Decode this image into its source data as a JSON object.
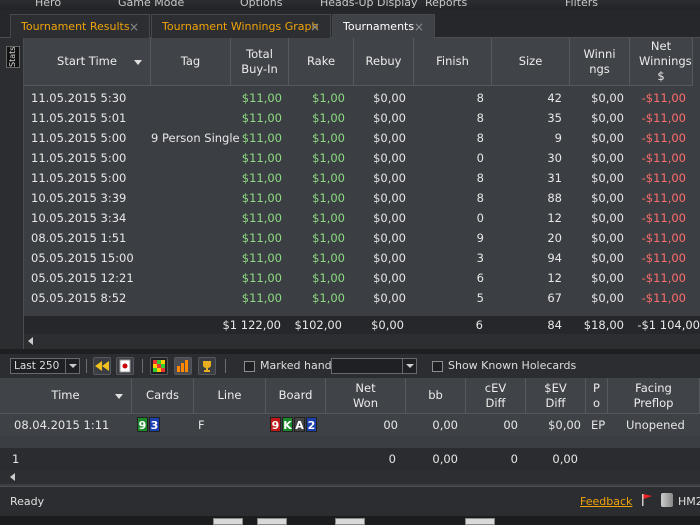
{
  "menu": [
    "Hero",
    "Game Mode",
    "Options",
    "Heads-Up Display",
    "Reports",
    "Filters"
  ],
  "tabs": [
    {
      "label": "Tournament Results",
      "active": false
    },
    {
      "label": "Tournament Winnings Graph",
      "active": false
    },
    {
      "label": "Tournaments",
      "active": true
    }
  ],
  "sidebar": {
    "stats_label": "Stats"
  },
  "top_grid": {
    "headers": [
      "Start Time",
      "Tag",
      "Total Buy-In",
      "Rake",
      "Rebuy",
      "Finish",
      "Size",
      "Winnings",
      "Net Winnings $"
    ],
    "rows": [
      [
        "11.05.2015 5:30",
        "",
        "$11,00",
        "$1,00",
        "$0,00",
        "8",
        "42",
        "$0,00",
        "-$11,00"
      ],
      [
        "11.05.2015 5:01",
        "",
        "$11,00",
        "$1,00",
        "$0,00",
        "8",
        "35",
        "$0,00",
        "-$11,00"
      ],
      [
        "11.05.2015 5:00",
        "9 Person Single",
        "$11,00",
        "$1,00",
        "$0,00",
        "8",
        "9",
        "$0,00",
        "-$11,00"
      ],
      [
        "11.05.2015 5:00",
        "",
        "$11,00",
        "$1,00",
        "$0,00",
        "0",
        "30",
        "$0,00",
        "-$11,00"
      ],
      [
        "11.05.2015 5:00",
        "",
        "$11,00",
        "$1,00",
        "$0,00",
        "8",
        "31",
        "$0,00",
        "-$11,00"
      ],
      [
        "10.05.2015 3:39",
        "",
        "$11,00",
        "$1,00",
        "$0,00",
        "8",
        "88",
        "$0,00",
        "-$11,00"
      ],
      [
        "10.05.2015 3:34",
        "",
        "$11,00",
        "$1,00",
        "$0,00",
        "0",
        "12",
        "$0,00",
        "-$11,00"
      ],
      [
        "08.05.2015 1:51",
        "",
        "$11,00",
        "$1,00",
        "$0,00",
        "9",
        "20",
        "$0,00",
        "-$11,00"
      ],
      [
        "05.05.2015 15:00",
        "",
        "$11,00",
        "$1,00",
        "$0,00",
        "3",
        "94",
        "$0,00",
        "-$11,00"
      ],
      [
        "05.05.2015 12:21",
        "",
        "$11,00",
        "$1,00",
        "$0,00",
        "6",
        "12",
        "$0,00",
        "-$11,00"
      ],
      [
        "05.05.2015 8:52",
        "",
        "$11,00",
        "$1,00",
        "$0,00",
        "5",
        "67",
        "$0,00",
        "-$11,00"
      ]
    ],
    "totals": [
      "$1 122,00",
      "$102,00",
      "$0,00",
      "6",
      "84",
      "$18,00",
      "-$1 104,00"
    ]
  },
  "toolbar": {
    "limit_value": "Last 250",
    "marked_hands_label": "Marked hands",
    "show_known_label": "Show Known Holecards"
  },
  "bottom_grid": {
    "headers": [
      "Time",
      "Cards",
      "Line",
      "Board",
      "Net Won",
      "bb",
      "cEV Diff",
      "$EV Diff",
      "Po",
      "Facing Preflop"
    ],
    "row": {
      "time": "08.04.2015 1:11",
      "cards": [
        "9",
        "3"
      ],
      "line": "F",
      "board": [
        "9",
        "K",
        "A",
        "2"
      ],
      "net_won": "00",
      "bb": "0,00",
      "cev": "00",
      "sev": "$0,00",
      "po": "EP",
      "facing": "Unopened"
    },
    "totals": [
      "1",
      "0",
      "0,00",
      "0",
      "0,00"
    ]
  },
  "status": {
    "ready": "Ready",
    "feedback": "Feedback",
    "app": "HM2"
  },
  "colors": {
    "accent": "#f0a30a",
    "positive": "#8ddc83",
    "negative": "#ff6d6d"
  }
}
